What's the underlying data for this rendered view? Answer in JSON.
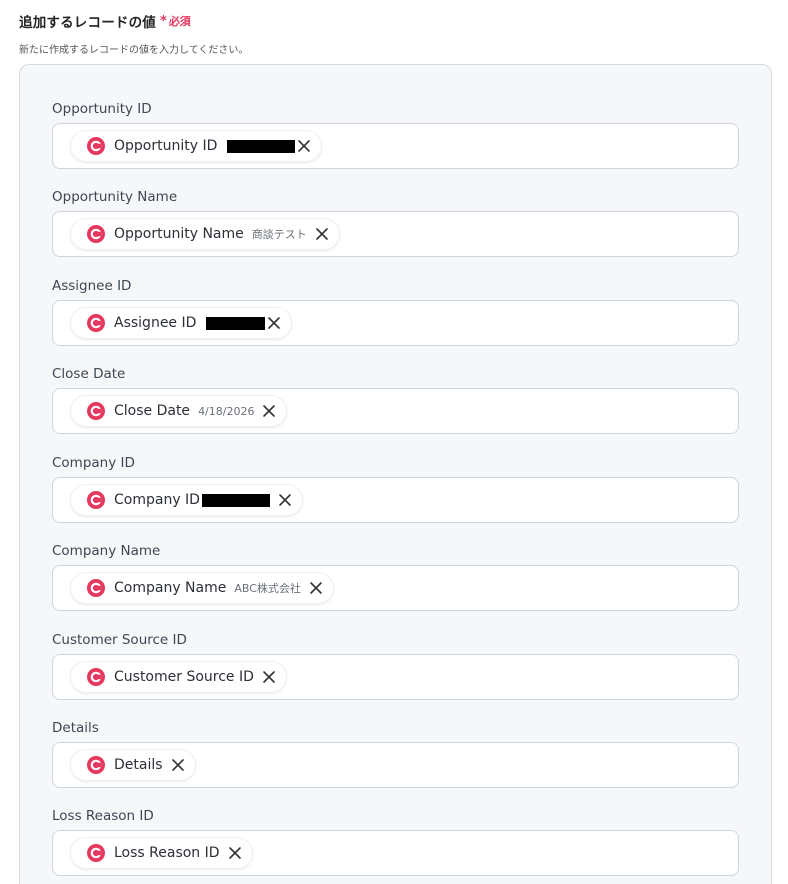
{
  "section": {
    "title": "追加するレコードの値",
    "required_mark": "*",
    "required_text": "必須",
    "description": "新たに作成するレコードの値を入力してください。"
  },
  "colors": {
    "accent": "#e5385f",
    "panel_bg": "#f6f7f9"
  },
  "fields": [
    {
      "label": "Opportunity ID",
      "chip": "Opportunity ID",
      "value": "",
      "redacted": true
    },
    {
      "label": "Opportunity Name",
      "chip": "Opportunity Name",
      "value": "商談テスト"
    },
    {
      "label": "Assignee ID",
      "chip": "Assignee ID",
      "value": "",
      "redacted": true
    },
    {
      "label": "Close Date",
      "chip": "Close Date",
      "value": "4/18/2026"
    },
    {
      "label": "Company ID",
      "chip": "Company ID",
      "value": "",
      "redacted": true
    },
    {
      "label": "Company Name",
      "chip": "Company Name",
      "value": "ABC株式会社"
    },
    {
      "label": "Customer Source ID",
      "chip": "Customer Source ID",
      "value": ""
    },
    {
      "label": "Details",
      "chip": "Details",
      "value": ""
    },
    {
      "label": "Loss Reason ID",
      "chip": "Loss Reason ID",
      "value": ""
    }
  ],
  "icons": {
    "app": "copper-app-icon",
    "remove": "close-icon"
  }
}
